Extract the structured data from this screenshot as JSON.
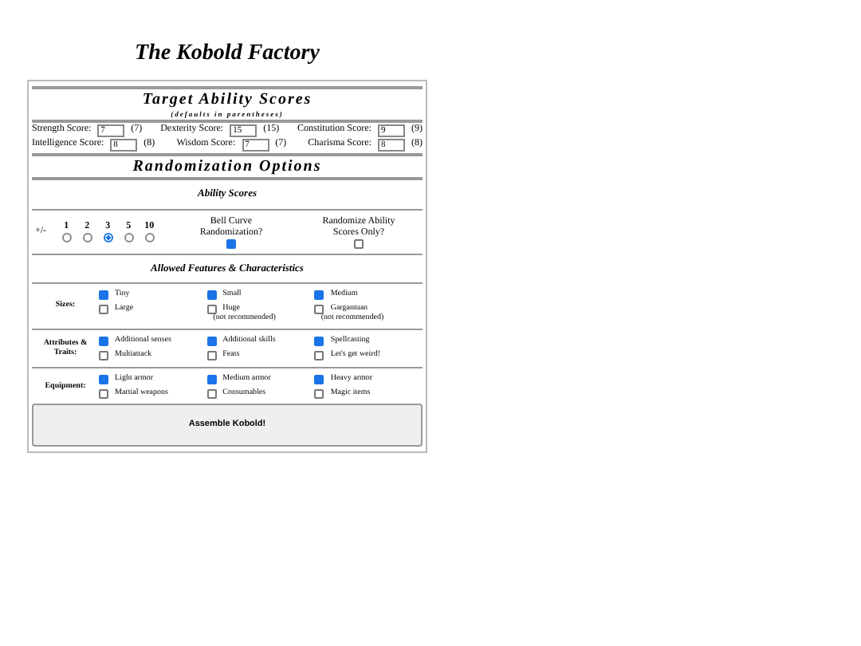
{
  "title": "The Kobold Factory",
  "target": {
    "heading": "Target Ability Scores",
    "subheading": "(defaults in parentheses)",
    "rows": [
      [
        {
          "label": "Strength Score:",
          "value": "7",
          "default": "(7)"
        },
        {
          "label": "Dexterity Score:",
          "value": "15",
          "default": "(15)"
        },
        {
          "label": "Constitution Score:",
          "value": "9",
          "default": "(9)"
        }
      ],
      [
        {
          "label": "Intelligence Score:",
          "value": "8",
          "default": "(8)"
        },
        {
          "label": "Wisdom Score:",
          "value": "7",
          "default": "(7)"
        },
        {
          "label": "Charisma Score:",
          "value": "8",
          "default": "(8)"
        }
      ]
    ]
  },
  "randomization": {
    "heading": "Randomization Options",
    "subheading": "Ability Scores",
    "spread_label": "+/-",
    "spread": [
      {
        "label": "1",
        "selected": false
      },
      {
        "label": "2",
        "selected": false
      },
      {
        "label": "3",
        "selected": true
      },
      {
        "label": "5",
        "selected": false
      },
      {
        "label": "10",
        "selected": false
      }
    ],
    "toggles": [
      {
        "label": "Bell Curve Randomization?",
        "checked": true
      },
      {
        "label": "Randomize Ability Scores Only?",
        "checked": false
      }
    ]
  },
  "features": {
    "heading": "Allowed Features & Characteristics",
    "groups": [
      {
        "label": "Sizes:",
        "options": [
          {
            "label": "Tiny",
            "checked": true
          },
          {
            "label": "Small",
            "checked": true
          },
          {
            "label": "Medium",
            "checked": true
          },
          {
            "label": "Large",
            "checked": false
          },
          {
            "label": "Huge",
            "note": "(not recommended)",
            "checked": false
          },
          {
            "label": "Gargantuan",
            "note": "(not recommended)",
            "checked": false
          }
        ]
      },
      {
        "label": "Attributes & Traits:",
        "options": [
          {
            "label": "Additional senses",
            "checked": true
          },
          {
            "label": "Additional skills",
            "checked": true
          },
          {
            "label": "Spellcasting",
            "checked": true
          },
          {
            "label": "Multiattack",
            "checked": false
          },
          {
            "label": "Feats",
            "checked": false
          },
          {
            "label": "Let's get weird!",
            "checked": false
          }
        ]
      },
      {
        "label": "Equipment:",
        "options": [
          {
            "label": "Light armor",
            "checked": true
          },
          {
            "label": "Medium armor",
            "checked": true
          },
          {
            "label": "Heavy armor",
            "checked": true
          },
          {
            "label": "Martial weapons",
            "checked": false
          },
          {
            "label": "Consumables",
            "checked": false
          },
          {
            "label": "Magic items",
            "checked": false
          }
        ]
      }
    ]
  },
  "button": "Assemble Kobold!"
}
